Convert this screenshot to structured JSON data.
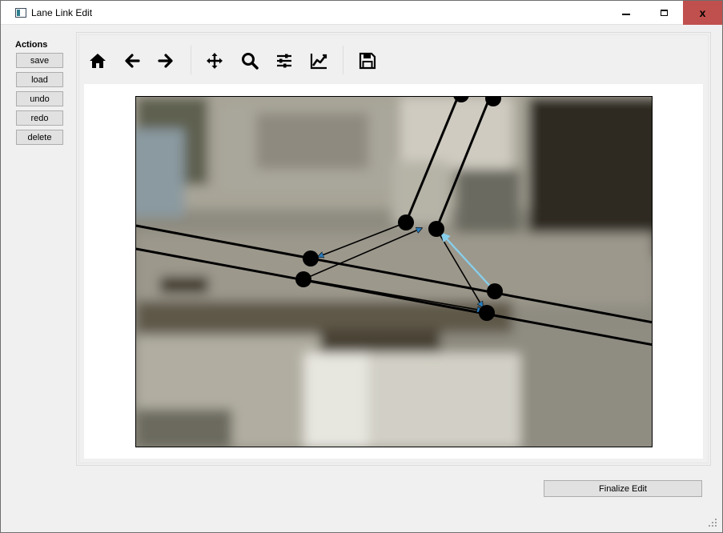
{
  "window": {
    "title": "Lane Link Edit",
    "minimize_icon": "minimize-icon",
    "maximize_icon": "maximize-icon",
    "close_label": "x",
    "close_color": "#c0504d"
  },
  "actions": {
    "heading": "Actions",
    "buttons": [
      "save",
      "load",
      "undo",
      "redo",
      "delete"
    ]
  },
  "toolbar": {
    "icons": [
      "home-icon",
      "back-arrow-icon",
      "forward-arrow-icon",
      "pan-icon",
      "zoom-icon",
      "configure-subplots-icon",
      "edit-axis-icon",
      "save-figure-icon"
    ]
  },
  "map": {
    "background": "aerial-road-imagery",
    "link_color": "#000000",
    "arrow_color": "#1f77b4",
    "selected_link_color": "#87ceeb",
    "node_color": "#000000"
  },
  "footer": {
    "finalize_label": "Finalize Edit"
  }
}
